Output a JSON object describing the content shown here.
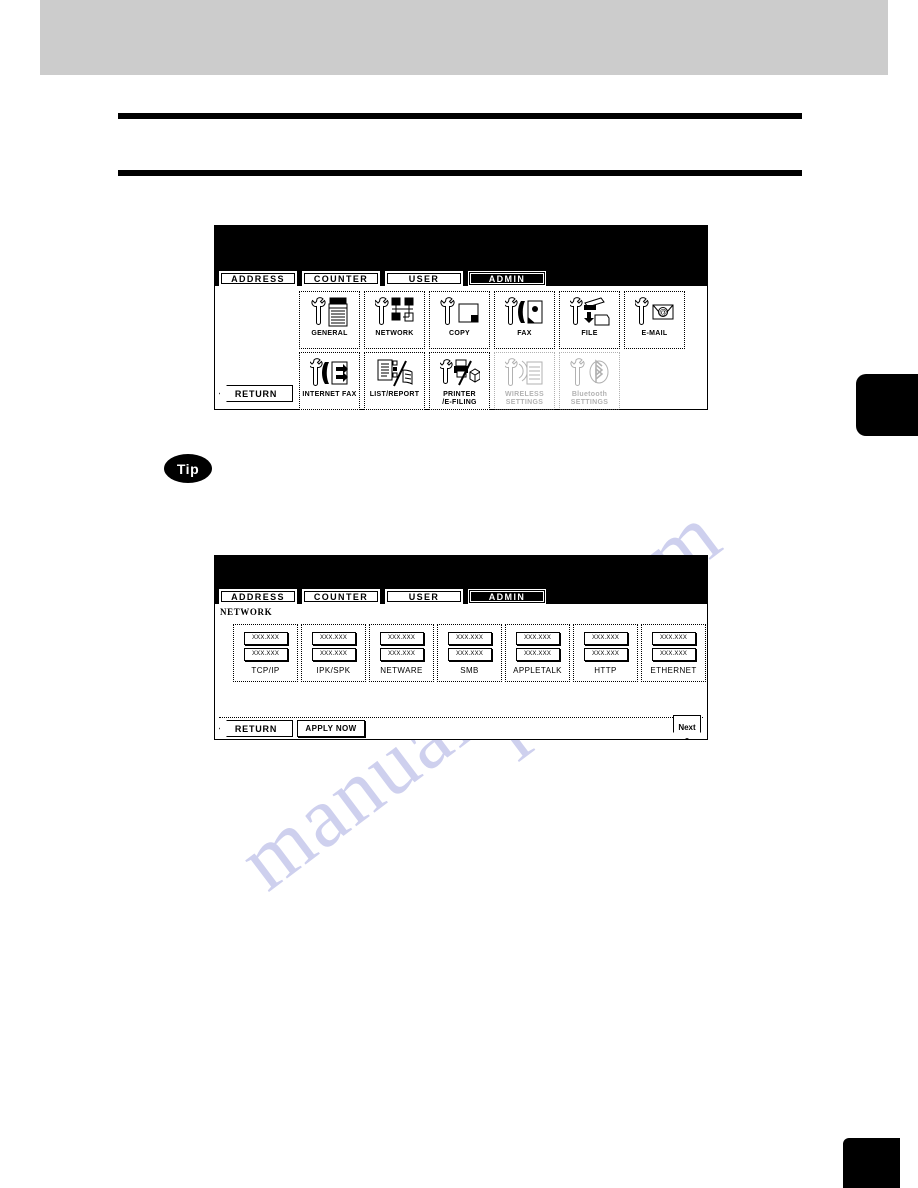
{
  "page": {
    "watermark_lines": [
      "manualslib.com",
      "ive.c"
    ]
  },
  "tip": {
    "label": "Tip"
  },
  "panel1": {
    "name": "admin-menu-screen",
    "tabs": [
      {
        "label": "ADDRESS",
        "selected": false
      },
      {
        "label": "COUNTER",
        "selected": false
      },
      {
        "label": "USER",
        "selected": false
      },
      {
        "label": "ADMIN",
        "selected": true
      }
    ],
    "buttons_row1": [
      {
        "label": "GENERAL",
        "icon": "wrench-printer-icon",
        "enabled": true
      },
      {
        "label": "NETWORK",
        "icon": "wrench-network-icon",
        "enabled": true
      },
      {
        "label": "COPY",
        "icon": "wrench-copy-icon",
        "enabled": true
      },
      {
        "label": "FAX",
        "icon": "wrench-fax-icon",
        "enabled": true
      },
      {
        "label": "FILE",
        "icon": "wrench-file-icon",
        "enabled": true
      },
      {
        "label": "E-MAIL",
        "icon": "wrench-email-icon",
        "enabled": true
      }
    ],
    "buttons_row2": [
      {
        "label": "INTERNET FAX",
        "icon": "wrench-internet-fax-icon",
        "enabled": true
      },
      {
        "label": "LIST/REPORT",
        "icon": "list-report-icon",
        "enabled": true
      },
      {
        "label": "PRINTER\n/E-FILING",
        "icon": "wrench-printer-efiling-icon",
        "enabled": true
      },
      {
        "label": "WIRELESS\nSETTINGS",
        "icon": "wrench-wireless-icon",
        "enabled": false
      },
      {
        "label": "Bluetooth\nSETTINGS",
        "icon": "wrench-bluetooth-icon",
        "enabled": false
      }
    ],
    "return_label": "RETURN"
  },
  "panel2": {
    "name": "network-settings-screen",
    "tabs": [
      {
        "label": "ADDRESS",
        "selected": false
      },
      {
        "label": "COUNTER",
        "selected": false
      },
      {
        "label": "USER",
        "selected": false
      },
      {
        "label": "ADMIN",
        "selected": true
      }
    ],
    "section_label": "NETWORK",
    "field_placeholder_top": "XXX.XXX",
    "field_placeholder_bottom": "XXX.XXX",
    "buttons": [
      {
        "label": "TCP/IP"
      },
      {
        "label": "IPK/SPK"
      },
      {
        "label": "NETWARE"
      },
      {
        "label": "SMB"
      },
      {
        "label": "APPLETALK"
      },
      {
        "label": "HTTP"
      },
      {
        "label": "ETHERNET"
      }
    ],
    "return_label": "RETURN",
    "apply_label": "APPLY NOW",
    "next_label": "Next"
  },
  "colors": {
    "panel_bar": "#000000",
    "page_band": "#cccccc",
    "watermark": "#ced0ee"
  }
}
